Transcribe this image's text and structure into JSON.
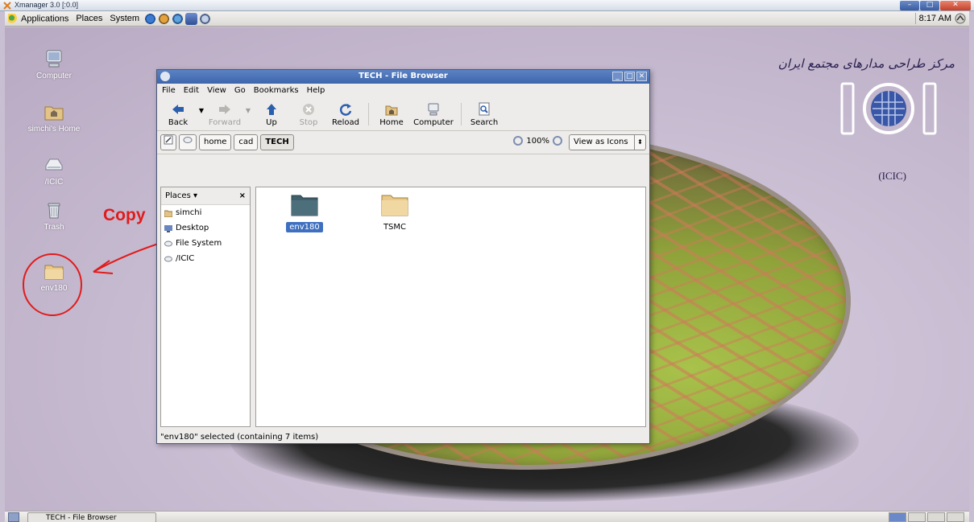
{
  "xmanager": {
    "title": "Xmanager 3.0 [:0.0]"
  },
  "top_panel": {
    "menus": [
      "Applications",
      "Places",
      "System"
    ],
    "clock": "8:17 AM"
  },
  "desktop": {
    "icons": [
      {
        "label": "Computer",
        "icon": "computer-icon"
      },
      {
        "label": "simchi's Home",
        "icon": "home-folder-icon"
      },
      {
        "label": "/ICIC",
        "icon": "drive-icon"
      },
      {
        "label": "Trash",
        "icon": "trash-icon"
      },
      {
        "label": "env180",
        "icon": "folder-icon"
      }
    ],
    "logo": {
      "fa_text": "مرکز طراحی مدارهای مجتمع ایران",
      "label": "(ICIC)"
    },
    "annotation": {
      "text": "Copy",
      "color": "#e11b1b"
    }
  },
  "file_browser": {
    "title": "TECH - File Browser",
    "menubar": [
      "File",
      "Edit",
      "View",
      "Go",
      "Bookmarks",
      "Help"
    ],
    "toolbar": {
      "back": "Back",
      "forward": "Forward",
      "up": "Up",
      "stop": "Stop",
      "reload": "Reload",
      "home": "Home",
      "computer": "Computer",
      "search": "Search"
    },
    "breadcrumbs": [
      "home",
      "cad",
      "TECH"
    ],
    "zoom": "100%",
    "view_mode": "View as Icons",
    "sidepane": {
      "header": "Places",
      "close": "×",
      "items": [
        "simchi",
        "Desktop",
        "File System",
        "/ICIC"
      ]
    },
    "files": [
      {
        "name": "env180",
        "selected": true,
        "color": "#3f5f6b"
      },
      {
        "name": "TSMC",
        "selected": false,
        "color": "#e9c98a"
      }
    ],
    "status": "\"env180\" selected (containing 7 items)"
  },
  "bottom_panel": {
    "task": "TECH - File Browser"
  }
}
